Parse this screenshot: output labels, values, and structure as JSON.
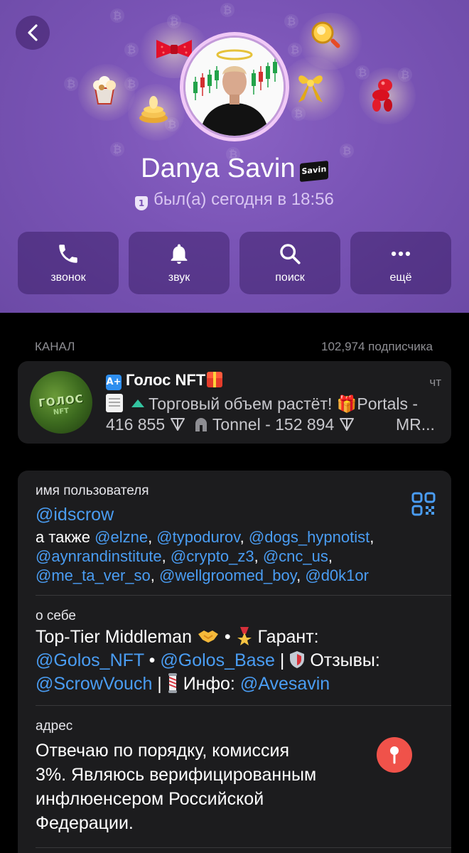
{
  "header": {
    "profile_name": "Danya Savin",
    "name_badge": "Savin",
    "status_badge": "1",
    "status": "был(а) сегодня в 18:56"
  },
  "actions": [
    {
      "label": "звонок",
      "icon": "phone-icon"
    },
    {
      "label": "звук",
      "icon": "bell-icon"
    },
    {
      "label": "поиск",
      "icon": "search-icon"
    },
    {
      "label": "ещё",
      "icon": "more-icon"
    }
  ],
  "channel_section": {
    "label": "КАНАЛ",
    "subscribers": "102,974 подписчика"
  },
  "channel": {
    "avatar_text": "ГОЛОС",
    "avatar_sub": "NFT",
    "badge": "A+",
    "title": "Голос NFT",
    "day": "чт",
    "line1": "Торговый объем растёт! 🎁Portals -",
    "line2_left": "416 855",
    "line2_mid": "Tonnel - 152 894",
    "line2_right": "MR..."
  },
  "username": {
    "label": "имя пользователя",
    "value": "@idscrow",
    "also_prefix": "а также",
    "also": [
      "@elzne",
      "@typodurov",
      "@dogs_hypnotist",
      "@aynrandinstitute",
      "@crypto_z3",
      "@cnc_us",
      "@me_ta_ver_so",
      "@wellgroomed_boy",
      "@d0k1or"
    ]
  },
  "bio": {
    "label": "о себе",
    "t1": "Top-Tier Middleman",
    "t2": "Гарант:",
    "l1": "@Golos_NFT",
    "l2": "@Golos_Base",
    "t3": "Отзывы:",
    "l3": "@ScrowVouch",
    "t4": "Инфо:",
    "l4": "@Avesavin"
  },
  "address": {
    "label": "адрес",
    "lines": [
      "Отвечаю по порядку, комиссия",
      "3%. Являюсь верифицированным",
      "инфлюенсером Российской",
      "Федерации."
    ]
  },
  "colors": {
    "header_bg": "#7a54b6",
    "link": "#4a9df3",
    "card_bg": "#1c1c1e",
    "pin": "#f0524a"
  }
}
